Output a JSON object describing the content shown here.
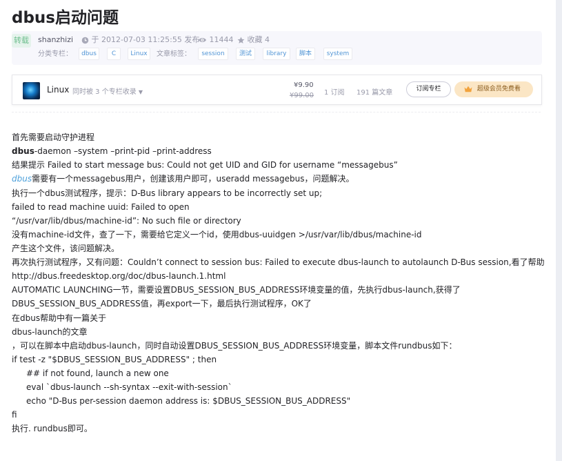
{
  "article": {
    "title": "dbus启动问题",
    "repost_badge": "转载",
    "author": "shanzhizi",
    "publish_date_prefix": "于",
    "publish_date": "2012-07-03 11:25:55",
    "publish_label": "发布",
    "views": "11444",
    "favorites_label": "收藏",
    "favorites": "4",
    "category_label": "分类专栏：",
    "categories": [
      "dbus",
      "C",
      "Linux"
    ],
    "tag_label": "文章标签：",
    "tags": [
      "session",
      "测试",
      "library",
      "脚本",
      "system"
    ]
  },
  "column": {
    "name": "Linux",
    "included_text": "同时被 3 个专栏收录",
    "price_now": "¥9.90",
    "price_old": "¥99.00",
    "subscribers": "1 订阅",
    "articles": "191 篇文章",
    "subscribe_button": "订阅专栏",
    "vip_button": "超级会员免费看"
  },
  "content": {
    "l1": "首先需要启动守护进程",
    "l2_bold": "dbus",
    "l2_rest": "-daemon –system  –print-pid –print-address",
    "l3": "结果提示 Failed to start message bus: Could not get UID and GID for username “messagebus”",
    "l4_link": "dbus",
    "l4_rest": "需要有一个messagebus用户，创建该用户即可，useradd messagebus，问题解决。",
    "l5": "执行一个dbus测试程序，提示：D-Bus library appears to be incorrectly set up;",
    "l6": "failed to read machine uuid: Failed to open",
    "l7": "“/usr/var/lib/dbus/machine-id”: No such file or directory",
    "l8": "没有machine-id文件，查了一下，需要给它定义一个id，使用dbus-uuidgen >/usr/var/lib/dbus/machine-id",
    "l9": "产生这个文件，该问题解决。",
    "l10": "再次执行测试程序，又有问题：Couldn’t connect to session bus: Failed to execute dbus-launch to autolaunch D-Bus session,看了帮助",
    "l11": "http://dbus.freedesktop.org/doc/dbus-launch.1.html",
    "l12": "AUTOMATIC LAUNCHING一节，需要设置DBUS_SESSION_BUS_ADDRESS环境变量的值，先执行dbus-launch,获得了",
    "l13": "DBUS_SESSION_BUS_ADDRESS值，再export一下，最后执行测试程序，OK了",
    "l14": "在dbus帮助中有一篇关于",
    "l15": "dbus-launch的文章",
    "l16": "，可以在脚本中启动dbus-launch，同时自动设置DBUS_SESSION_BUS_ADDRESS环境变量，脚本文件rundbus如下：",
    "l17": "if test -z \"$DBUS_SESSION_BUS_ADDRESS\" ; then",
    "l18": "## if not found, launch a new one",
    "l19": "eval `dbus-launch --sh-syntax --exit-with-session`",
    "l20": "echo \"D-Bus per-session daemon address is: $DBUS_SESSION_BUS_ADDRESS\"",
    "l21": "fi",
    "l22": "执行. rundbus即可。"
  },
  "colors": {
    "link": "#4ea1db",
    "tag_text": "#5094d5",
    "repost_badge_bg": "#e5f3ec",
    "repost_badge_text": "#6cbd8c",
    "vip_button_bg": "#fbe6c5"
  },
  "icons": [
    "clock-icon",
    "eye-icon",
    "star-icon",
    "caret-down-icon",
    "crown-icon"
  ]
}
